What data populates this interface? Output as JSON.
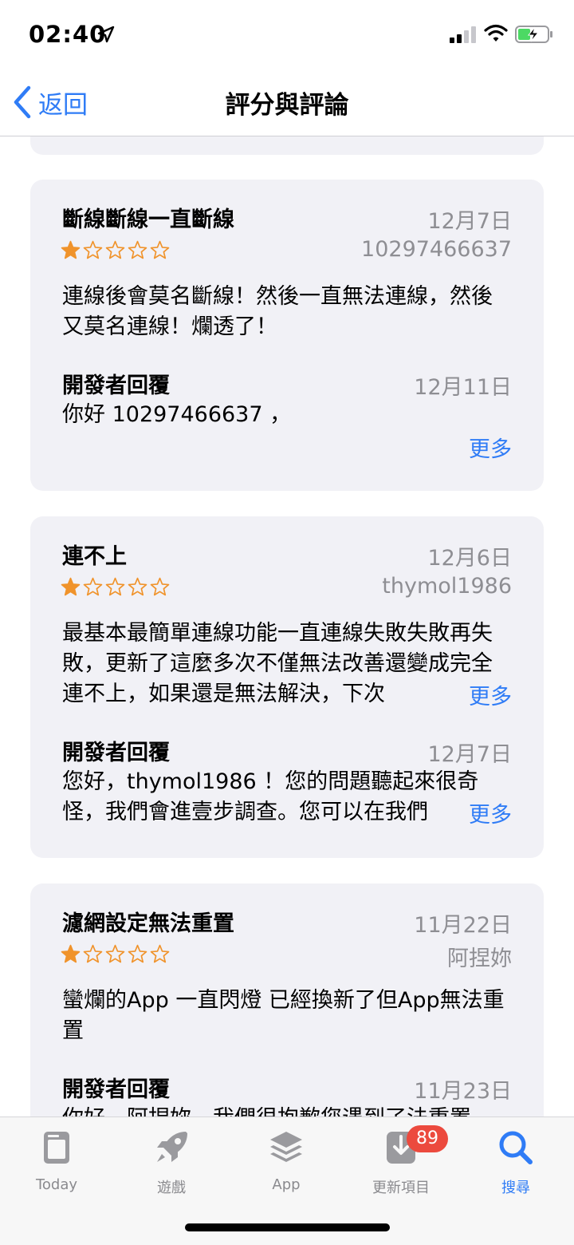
{
  "status_bar": {
    "time": "02:40"
  },
  "nav": {
    "back_label": "返回",
    "title": "評分與評論"
  },
  "reviews": [
    {
      "title": "斷線斷線一直斷線",
      "date": "12月7日",
      "author": "10297466637",
      "rating": 1,
      "max_rating": 5,
      "body": "連線後會莫名斷線！然後一直無法連線，然後又莫名連線！爛透了！",
      "developer_reply": {
        "label": "開發者回覆",
        "date": "12月11日",
        "text": "你好 10297466637 ，",
        "more": "更多"
      }
    },
    {
      "title": "連不上",
      "date": "12月6日",
      "author": "thymol1986",
      "rating": 1,
      "max_rating": 5,
      "body": "最基本最簡單連線功能一直連線失敗失敗再失敗，更新了這麼多次不僅無法改善還變成完全連不上，如果還是無法解決，下次",
      "body_more": "更多",
      "developer_reply": {
        "label": "開發者回覆",
        "date": "12月7日",
        "text": "您好，thymol1986 ！您的問題聽起來很奇怪，我們會進壹步調查。您可以在我們",
        "more": "更多"
      }
    },
    {
      "title": "濾網設定無法重置",
      "date": "11月22日",
      "author": "阿捏妳",
      "rating": 1,
      "max_rating": 5,
      "body": "蠻爛的App 一直閃燈 已經換新了但App無法重置",
      "developer_reply": {
        "label": "開發者回覆",
        "date": "11月23日",
        "text": "你好，阿捏妳，我們很抱歉您遇到了法重置"
      }
    }
  ],
  "tab_bar": {
    "tabs": [
      {
        "label": "Today",
        "icon": "today-icon"
      },
      {
        "label": "遊戲",
        "icon": "rocket-icon"
      },
      {
        "label": "App",
        "icon": "stack-icon"
      },
      {
        "label": "更新項目",
        "icon": "download-icon",
        "badge": "89"
      },
      {
        "label": "搜尋",
        "icon": "search-icon",
        "active": true
      }
    ]
  },
  "colors": {
    "accent": "#2f7cf6",
    "star": "#f0932b",
    "badge": "#ec4a3e",
    "card": "#f1f1f6"
  }
}
